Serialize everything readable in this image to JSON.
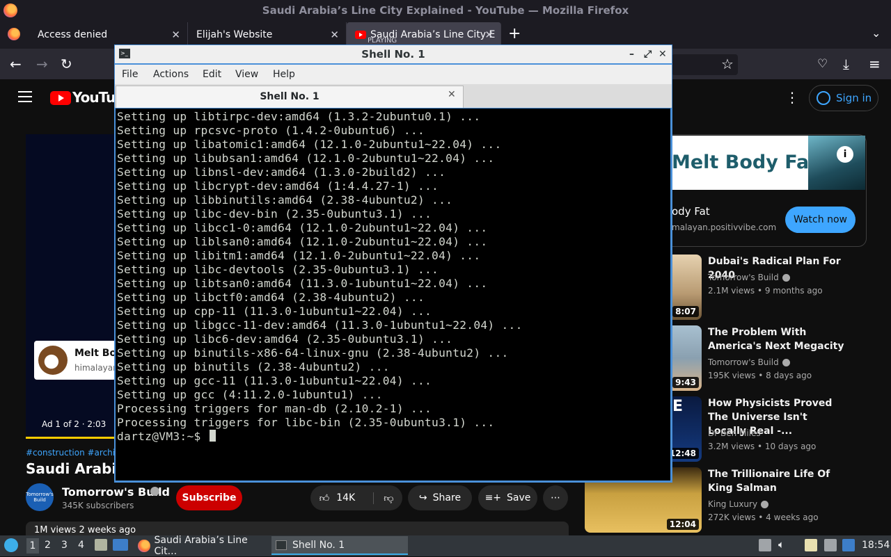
{
  "firefox": {
    "window_title": "Saudi Arabia’s Line City Explained - YouTube — Mozilla Firefox",
    "tabs": [
      {
        "label": "Access denied"
      },
      {
        "label": "Elijah's Website"
      },
      {
        "label": "Saudi Arabia’s Line City E",
        "status": "PLAYING"
      }
    ]
  },
  "youtube": {
    "logo_text": "YouTube",
    "sign_in": "Sign in",
    "player": {
      "ad_card_title": "Melt Bod",
      "ad_card_url": "himalayan",
      "ad_counter": "Ad 1 of 2 · 2:03",
      "progress": 1.0
    },
    "hashtags": "#construction #archited",
    "title": "Saudi Arabia’s L",
    "channel": {
      "name": "Tomorrow's Build",
      "subscribers": "345K subscribers",
      "avatar_text": "Tomorrow's Build"
    },
    "subscribe": "Subscribe",
    "likes": "14K",
    "share": "Share",
    "save": "Save",
    "more": "⋯",
    "description_preview": "1M views  2 weeks ago",
    "ad": {
      "banner_text": "Melt Body Fat",
      "title": "ody Fat",
      "url": "malayan.positivvibe.com",
      "cta": "Watch now"
    },
    "recommendations": [
      {
        "title": "Dubai's Radical Plan For 2040",
        "channel": "Tomorrow's Build",
        "meta": "2.1M views • 9 months ago",
        "duration": "8:07",
        "color": "#b89a72",
        "verified": true
      },
      {
        "title": "The Problem With America's Next Megacity",
        "channel": "Tomorrow's Build",
        "meta": "195K views • 8 days ago",
        "duration": "9:43",
        "color": "#8aa0b0",
        "verified": true
      },
      {
        "title": "How Physicists Proved The Universe Isn't Locally Real -...",
        "channel": "Dr Ben Miles",
        "meta": "3.2M views • 10 days ago",
        "duration": "12:48",
        "color": "#0a1a40",
        "verified": false
      },
      {
        "title": "The Trillionaire Life Of King Salman",
        "channel": "King Luxury",
        "meta": "272K views • 4 weeks ago",
        "duration": "12:04",
        "color": "#c8a040",
        "verified": true
      }
    ]
  },
  "terminal": {
    "title": "Shell No. 1",
    "menu": [
      "File",
      "Actions",
      "Edit",
      "View",
      "Help"
    ],
    "tab": "Shell No. 1",
    "lines": [
      "Setting up libtirpc-dev:amd64 (1.3.2-2ubuntu0.1) ...",
      "Setting up rpcsvc-proto (1.4.2-0ubuntu6) ...",
      "Setting up libatomic1:amd64 (12.1.0-2ubuntu1~22.04) ...",
      "Setting up libubsan1:amd64 (12.1.0-2ubuntu1~22.04) ...",
      "Setting up libnsl-dev:amd64 (1.3.0-2build2) ...",
      "Setting up libcrypt-dev:amd64 (1:4.4.27-1) ...",
      "Setting up libbinutils:amd64 (2.38-4ubuntu2) ...",
      "Setting up libc-dev-bin (2.35-0ubuntu3.1) ...",
      "Setting up libcc1-0:amd64 (12.1.0-2ubuntu1~22.04) ...",
      "Setting up liblsan0:amd64 (12.1.0-2ubuntu1~22.04) ...",
      "Setting up libitm1:amd64 (12.1.0-2ubuntu1~22.04) ...",
      "Setting up libc-devtools (2.35-0ubuntu3.1) ...",
      "Setting up libtsan0:amd64 (11.3.0-1ubuntu1~22.04) ...",
      "Setting up libctf0:amd64 (2.38-4ubuntu2) ...",
      "Setting up cpp-11 (11.3.0-1ubuntu1~22.04) ...",
      "Setting up libgcc-11-dev:amd64 (11.3.0-1ubuntu1~22.04) ...",
      "Setting up libc6-dev:amd64 (2.35-0ubuntu3.1) ...",
      "Setting up binutils-x86-64-linux-gnu (2.38-4ubuntu2) ...",
      "Setting up binutils (2.38-4ubuntu2) ...",
      "Setting up gcc-11 (11.3.0-1ubuntu1~22.04) ...",
      "Setting up gcc (4:11.2.0-1ubuntu1) ...",
      "Processing triggers for man-db (2.10.2-1) ...",
      "Processing triggers for libc-bin (2.35-0ubuntu3.1) ..."
    ],
    "prompt": "dartz@VM3:~$ "
  },
  "taskbar": {
    "workspaces": [
      "1",
      "2",
      "3",
      "4"
    ],
    "tasks": [
      "Saudi Arabia’s Line Cit...",
      "Shell No. 1"
    ],
    "clock": "18:54"
  }
}
